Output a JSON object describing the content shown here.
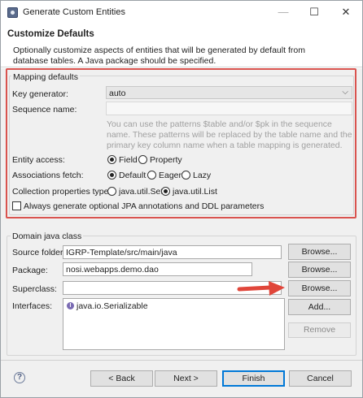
{
  "window": {
    "title": "Generate Custom Entities",
    "minimize": "—",
    "maximize": "☐",
    "close": "✕"
  },
  "header": {
    "title": "Customize Defaults",
    "description": "Optionally customize aspects of entities that will be generated by default from database tables. A Java package should be specified."
  },
  "mapping": {
    "group_label": "Mapping defaults",
    "key_generator_label": "Key generator:",
    "key_generator_value": "auto",
    "sequence_name_label": "Sequence name:",
    "sequence_name_value": "",
    "hint": "You can use the patterns $table and/or $pk in the sequence name. These patterns will be replaced by the table name and the primary key column name when a table mapping is generated.",
    "entity_access_label": "Entity access:",
    "entity_access_options": [
      "Field",
      "Property"
    ],
    "entity_access_selected": "Field",
    "associations_fetch_label": "Associations fetch:",
    "associations_fetch_options": [
      "Default",
      "Eager",
      "Lazy"
    ],
    "associations_fetch_selected": "Default",
    "collection_type_label": "Collection properties type:",
    "collection_type_options": [
      "java.util.Set",
      "java.util.List"
    ],
    "collection_type_selected": "java.util.List",
    "jpa_checkbox_label": "Always generate optional JPA annotations and DDL parameters",
    "jpa_checkbox_checked": false
  },
  "domain": {
    "group_label": "Domain java class",
    "source_folder_label": "Source folder:",
    "source_folder_value": "IGRP-Template/src/main/java",
    "package_label": "Package:",
    "package_value": "nosi.webapps.demo.dao",
    "superclass_label": "Superclass:",
    "superclass_value": "",
    "interfaces_label": "Interfaces:",
    "interfaces": [
      "java.io.Serializable"
    ],
    "browse_label": "Browse...",
    "add_label": "Add...",
    "remove_label": "Remove"
  },
  "footer": {
    "help_symbol": "?",
    "back_label": "< Back",
    "next_label": "Next >",
    "finish_label": "Finish",
    "cancel_label": "Cancel"
  },
  "colors": {
    "highlight_outline": "#d9534f",
    "arrow": "#e0463a",
    "default_button_border": "#0078d7"
  }
}
